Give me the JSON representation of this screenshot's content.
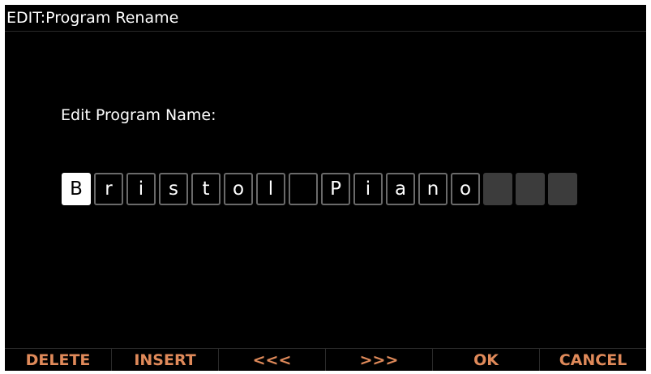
{
  "header": {
    "title": "EDIT:Program Rename"
  },
  "editor": {
    "prompt": "Edit Program Name:",
    "characters": [
      "B",
      "r",
      "i",
      "s",
      "t",
      "o",
      "l",
      " ",
      "P",
      "i",
      "a",
      "n",
      "o",
      "",
      "",
      ""
    ],
    "cursor_index": 0
  },
  "softkeys": {
    "delete": "DELETE",
    "insert": "INSERT",
    "left": "<<<",
    "right": ">>>",
    "ok": "OK",
    "cancel": "CANCEL"
  },
  "colors": {
    "screen_bg": "#000000",
    "text": "#ffffff",
    "softkey_text": "#e08a5a",
    "cell_border": "#6a6a6a",
    "cell_empty": "#3c3c3c"
  }
}
